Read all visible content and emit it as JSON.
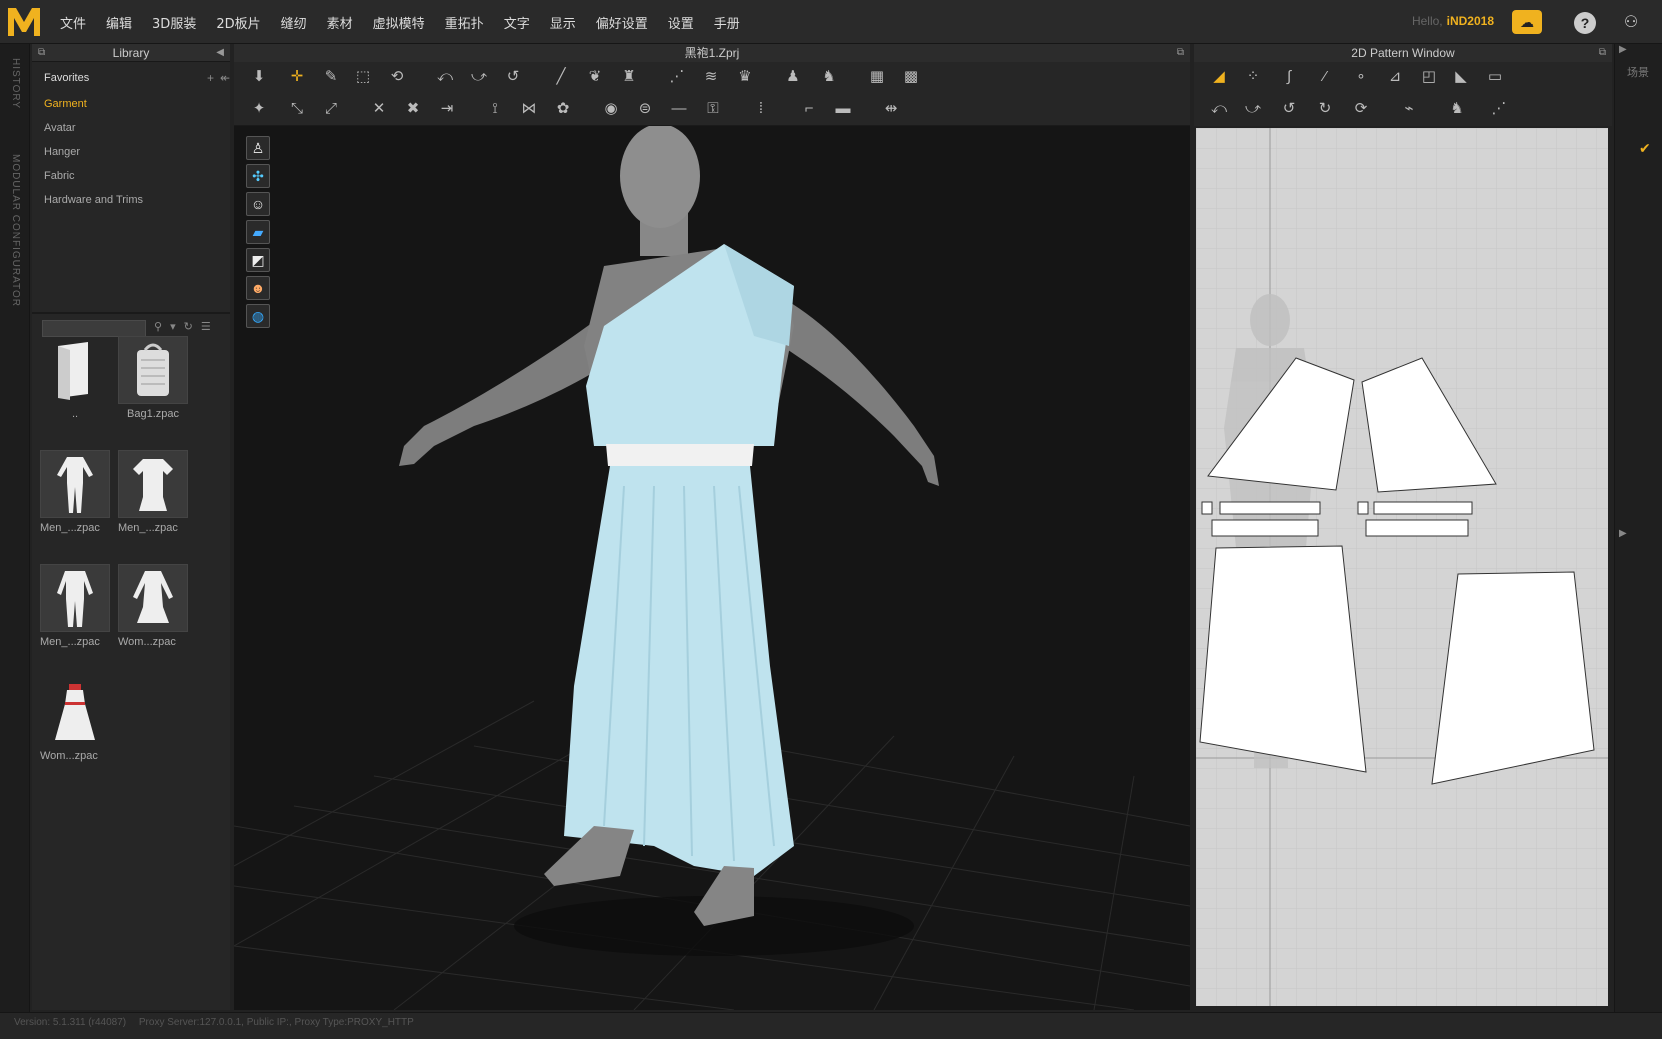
{
  "app": {
    "logo": "MD",
    "menu": [
      "文件",
      "编辑",
      "3D服装",
      "2D板片",
      "缝纫",
      "素材",
      "虚拟模特",
      "重拓扑",
      "文字",
      "显示",
      "偏好设置",
      "设置",
      "手册"
    ],
    "hello_label": "Hello,",
    "username": "iND2018"
  },
  "side_tabs": [
    "HISTORY",
    "MODULAR CONFIGURATOR"
  ],
  "library": {
    "title": "Library",
    "favorites_title": "Favorites",
    "items": [
      "Garment",
      "Avatar",
      "Hanger",
      "Fabric",
      "Hardware and Trims"
    ],
    "active_item": "Garment",
    "search_value": "",
    "thumbnails": [
      {
        "label": "..",
        "kind": "folder"
      },
      {
        "label": "Bag1.zpac",
        "kind": "bag"
      },
      {
        "label": "Men_...zpac",
        "kind": "suit"
      },
      {
        "label": "Men_...zpac",
        "kind": "tshirt"
      },
      {
        "label": "Men_...zpac",
        "kind": "suit2"
      },
      {
        "label": "Wom...zpac",
        "kind": "coat"
      },
      {
        "label": "Wom...zpac",
        "kind": "dress"
      }
    ]
  },
  "window3d": {
    "title": "黑袍1.Zprj"
  },
  "window2d": {
    "title": "2D Pattern Window"
  },
  "right_strip": {
    "label": "场景"
  },
  "status": {
    "version": "Version: 5.1.311 (r44087)",
    "proxy": "Proxy Server:127.0.0.1, Public IP:, Proxy Type:PROXY_HTTP"
  },
  "colors": {
    "accent": "#f0b21f",
    "garment": "#bfe3ee",
    "avatar": "#8a8a8a"
  }
}
